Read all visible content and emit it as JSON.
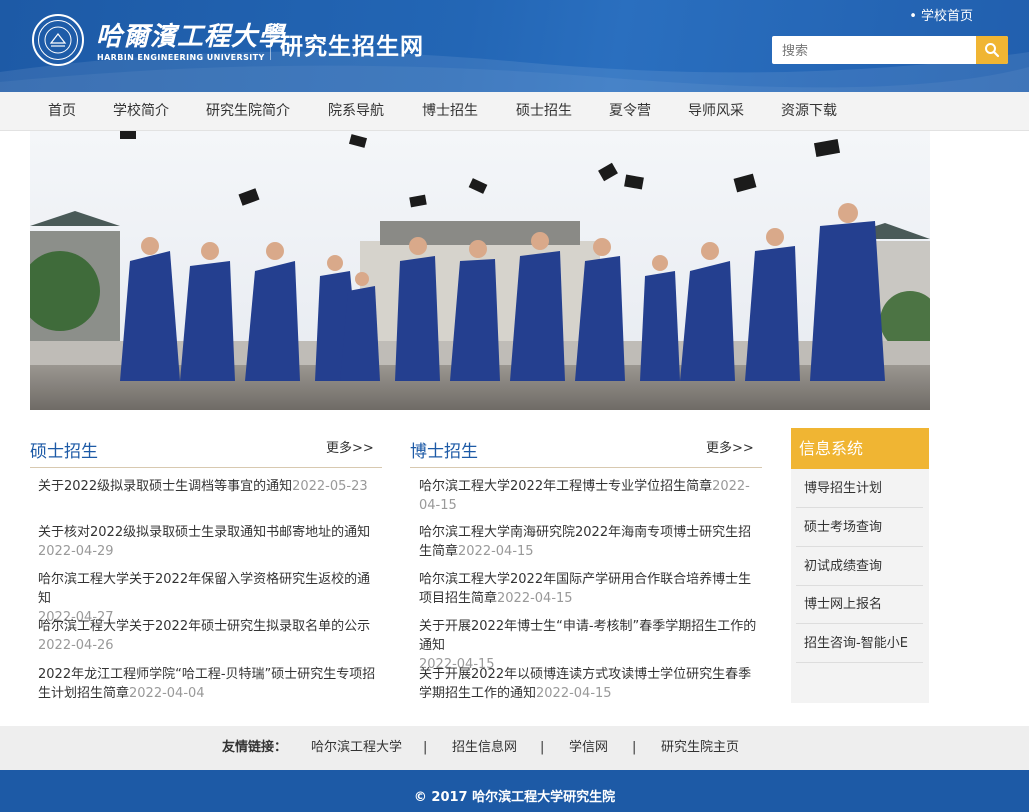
{
  "header": {
    "university_cn": "哈爾濱工程大學",
    "university_en": "HARBIN ENGINEERING UNIVERSITY",
    "site_title": "研究生招生网",
    "home_link": "• 学校首页",
    "search_placeholder": "搜索",
    "search_icon": "search-icon",
    "brand_color": "#1d5aa6",
    "accent_color": "#f0b533"
  },
  "nav": {
    "items": [
      "首页",
      "学校简介",
      "研究生院简介",
      "院系导航",
      "博士招生",
      "硕士招生",
      "夏令营",
      "导师风采",
      "资源下载"
    ]
  },
  "master": {
    "title": "硕士招生",
    "more": "更多>>",
    "items": [
      {
        "title": "关于2022级拟录取硕士生调档等事宜的通知",
        "date": "2022-05-23"
      },
      {
        "title": "关于核对2022级拟录取硕士生录取通知书邮寄地址的通知",
        "date": "2022-04-29"
      },
      {
        "title": "哈尔滨工程大学关于2022年保留入学资格研究生返校的通知",
        "date": "2022-04-27"
      },
      {
        "title": "哈尔滨工程大学关于2022年硕士研究生拟录取名单的公示",
        "date": "2022-04-26"
      },
      {
        "title": "2022年龙江工程师学院“哈工程-贝特瑞”硕士研究生专项招生计划招生简章",
        "date": "2022-04-04"
      }
    ]
  },
  "doctor": {
    "title": "博士招生",
    "more": "更多>>",
    "items": [
      {
        "title": "哈尔滨工程大学2022年工程博士专业学位招生简章",
        "date": "2022-04-15"
      },
      {
        "title": "哈尔滨工程大学南海研究院2022年海南专项博士研究生招生简章",
        "date": "2022-04-15"
      },
      {
        "title": "哈尔滨工程大学2022年国际产学研用合作联合培养博士生项目招生简章",
        "date": "2022-04-15"
      },
      {
        "title": "关于开展2022年博士生“申请-考核制”春季学期招生工作的通知",
        "date": "2022-04-15"
      },
      {
        "title": "关于开展2022年以硕博连读方式攻读博士学位研究生春季学期招生工作的通知",
        "date": "2022-04-15"
      }
    ]
  },
  "info_system": {
    "title": "信息系统",
    "links": [
      "博导招生计划",
      "硕士考场查询",
      "初试成绩查询",
      "博士网上报名",
      "招生咨询-智能小E"
    ]
  },
  "friends": {
    "label": "友情链接：",
    "links": [
      "哈尔滨工程大学",
      "招生信息网",
      "学信网",
      "研究生院主页"
    ],
    "separator": "|"
  },
  "footer": {
    "copyright": "© 2017 哈尔滨工程大学研究生院"
  }
}
